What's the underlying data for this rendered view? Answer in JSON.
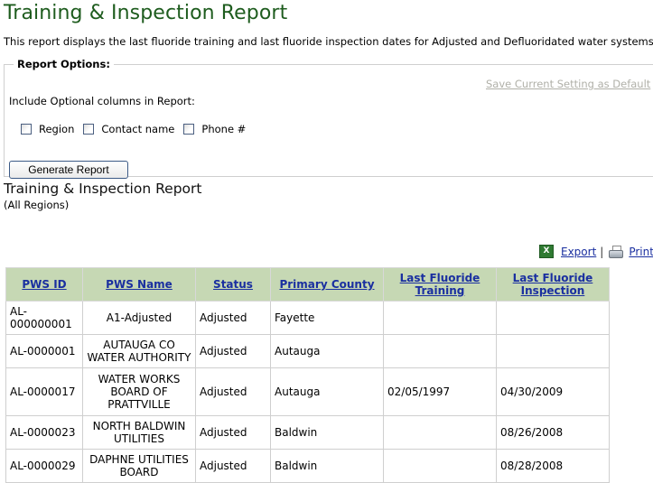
{
  "page": {
    "title": "Training & Inspection Report",
    "intro": "This report displays the last fluoride training and last fluoride inspection dates for Adjusted and Defluoridated water systems."
  },
  "options": {
    "legend": "Report Options:",
    "save_default_link": "Save Current Setting as Default",
    "include_label": "Include Optional columns in Report:",
    "checkboxes": [
      {
        "label": "Region",
        "checked": false
      },
      {
        "label": "Contact name",
        "checked": false
      },
      {
        "label": "Phone #",
        "checked": false
      }
    ],
    "generate_button": "Generate Report"
  },
  "report": {
    "title": "Training & Inspection Report",
    "region_scope": "(All Regions)",
    "export_icon": "excel-icon",
    "export_label": "Export",
    "separator": "|",
    "print_icon": "printer-icon",
    "print_label": "Print",
    "header_color": "#c6d8b4",
    "link_color": "#1a2fa0",
    "columns": [
      "PWS ID",
      "PWS Name",
      "Status",
      "Primary County",
      "Last Fluoride Training",
      "Last Fluoride Inspection"
    ],
    "rows": [
      {
        "pws_id": "AL-000000001",
        "pws_name": "A1-Adjusted",
        "status": "Adjusted",
        "county": "Fayette",
        "training": "",
        "inspection": ""
      },
      {
        "pws_id": "AL-0000001",
        "pws_name": "AUTAUGA CO WATER AUTHORITY",
        "status": "Adjusted",
        "county": "Autauga",
        "training": "",
        "inspection": ""
      },
      {
        "pws_id": "AL-0000017",
        "pws_name": "WATER WORKS BOARD OF PRATTVILLE",
        "status": "Adjusted",
        "county": "Autauga",
        "training": "02/05/1997",
        "inspection": "04/30/2009"
      },
      {
        "pws_id": "AL-0000023",
        "pws_name": "NORTH BALDWIN UTILITIES",
        "status": "Adjusted",
        "county": "Baldwin",
        "training": "",
        "inspection": "08/26/2008"
      },
      {
        "pws_id": "AL-0000029",
        "pws_name": "DAPHNE UTILITIES BOARD",
        "status": "Adjusted",
        "county": "Baldwin",
        "training": "",
        "inspection": "08/28/2008"
      }
    ]
  }
}
